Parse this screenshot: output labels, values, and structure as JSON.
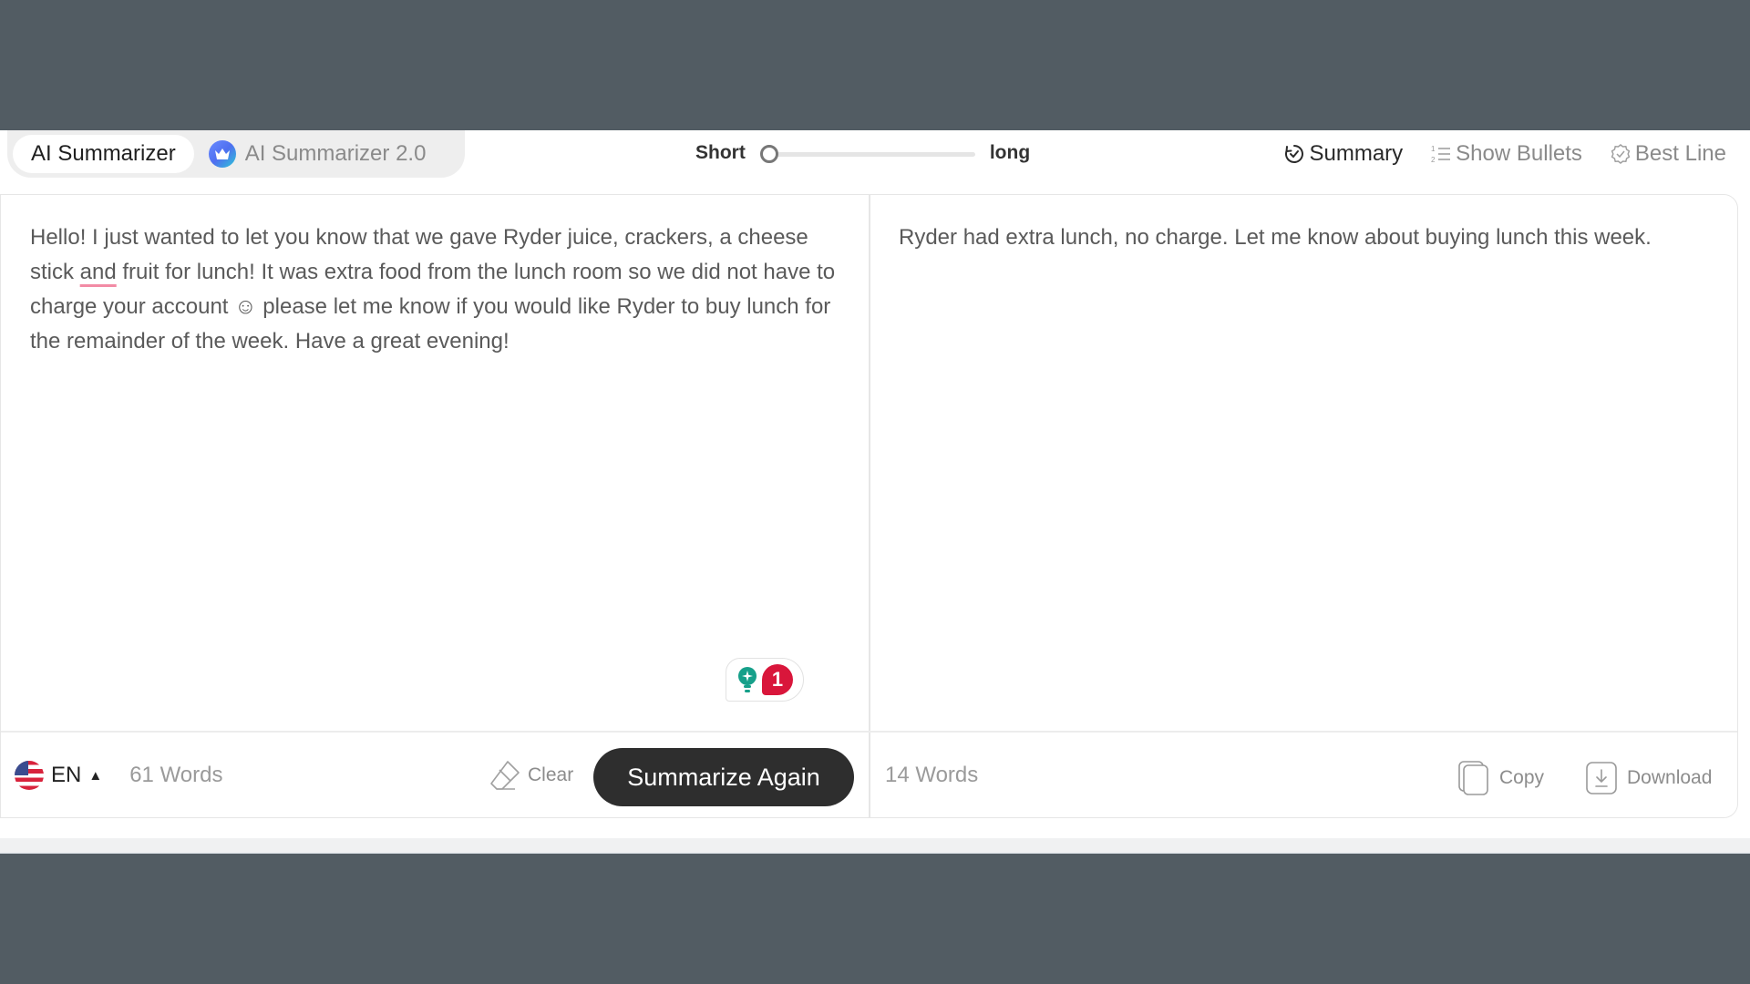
{
  "tabs": [
    {
      "label": "AI Summarizer",
      "active": true
    },
    {
      "label": "AI Summarizer 2.0",
      "active": false,
      "icon": "crown-icon"
    }
  ],
  "length": {
    "short_label": "Short",
    "long_label": "long",
    "value_fraction": 0.0
  },
  "modes": [
    {
      "label": "Summary",
      "icon": "summary-refresh-check-icon",
      "active": true
    },
    {
      "label": "Show Bullets",
      "icon": "numbered-list-icon",
      "active": false
    },
    {
      "label": "Best Line",
      "icon": "badge-check-icon",
      "active": false
    }
  ],
  "input": {
    "text_before": "Hello! I just wanted to let you know that we gave Ryder juice, crackers, a cheese stick ",
    "flagged_word": "and",
    "text_after": " fruit for lunch! It was extra food from the lunch room so we did not have to charge your account ☺ please let me know if you would like Ryder to buy lunch for the remainder of the week. Have a great evening!",
    "suggestion_count": "1",
    "language": "EN",
    "word_count": "61 Words",
    "clear_label": "Clear",
    "summarize_label": "Summarize Again"
  },
  "output": {
    "text": "Ryder had extra lunch, no charge. Let me know about buying lunch this week.",
    "word_count": "14 Words",
    "copy_label": "Copy",
    "download_label": "Download"
  },
  "colors": {
    "backdrop": "#525c63",
    "primary_button": "#2e2e2e",
    "badge_red": "#d9163b",
    "bulb_teal": "#16a08a",
    "underline_pink": "#f28ba5"
  }
}
